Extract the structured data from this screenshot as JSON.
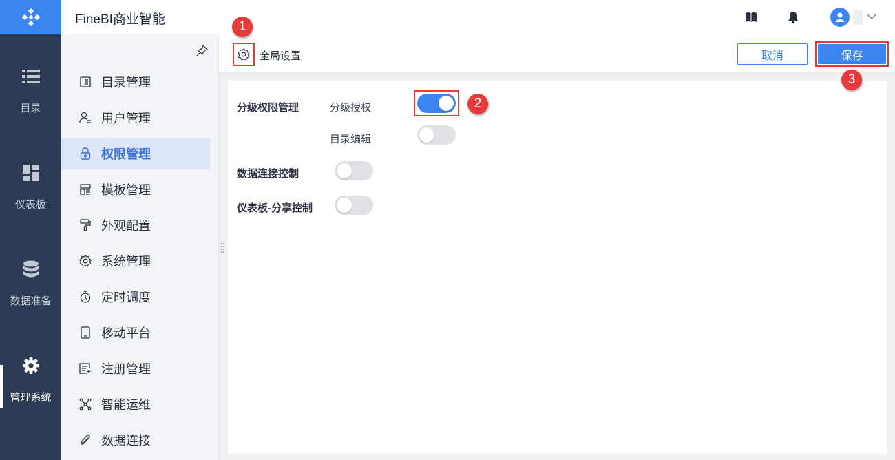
{
  "app": {
    "title": "FineBI商业智能"
  },
  "colors": {
    "accent": "#3b85f0",
    "rail": "#2d3c54",
    "highlight": "#e23b3b"
  },
  "rail": {
    "items": [
      {
        "label": "目录",
        "icon": "list-icon"
      },
      {
        "label": "仪表板",
        "icon": "dashboard-icon"
      },
      {
        "label": "数据准备",
        "icon": "database-icon"
      },
      {
        "label": "管理系统",
        "icon": "gear-icon",
        "active": true
      }
    ]
  },
  "menu": {
    "items": [
      {
        "label": "目录管理",
        "icon": "catalog-icon"
      },
      {
        "label": "用户管理",
        "icon": "user-icon"
      },
      {
        "label": "权限管理",
        "icon": "lock-icon",
        "active": true
      },
      {
        "label": "模板管理",
        "icon": "template-icon"
      },
      {
        "label": "外观配置",
        "icon": "paint-roller-icon"
      },
      {
        "label": "系统管理",
        "icon": "settings-icon"
      },
      {
        "label": "定时调度",
        "icon": "timer-icon"
      },
      {
        "label": "移动平台",
        "icon": "mobile-icon"
      },
      {
        "label": "注册管理",
        "icon": "register-icon"
      },
      {
        "label": "智能运维",
        "icon": "network-icon"
      },
      {
        "label": "数据连接",
        "icon": "paperclip-icon"
      }
    ]
  },
  "toolbar": {
    "global_settings_label": "全局设置",
    "cancel_label": "取消",
    "save_label": "保存"
  },
  "badges": {
    "one": "1",
    "two": "2",
    "three": "3"
  },
  "settings": {
    "hierarchical_permission": {
      "label": "分级权限管理",
      "options": [
        {
          "label": "分级授权",
          "enabled": true
        },
        {
          "label": "目录编辑",
          "enabled": false
        }
      ]
    },
    "data_connection_control": {
      "label": "数据连接控制",
      "enabled": false
    },
    "dashboard_share_control": {
      "label": "仪表板-分享控制",
      "enabled": false
    }
  }
}
